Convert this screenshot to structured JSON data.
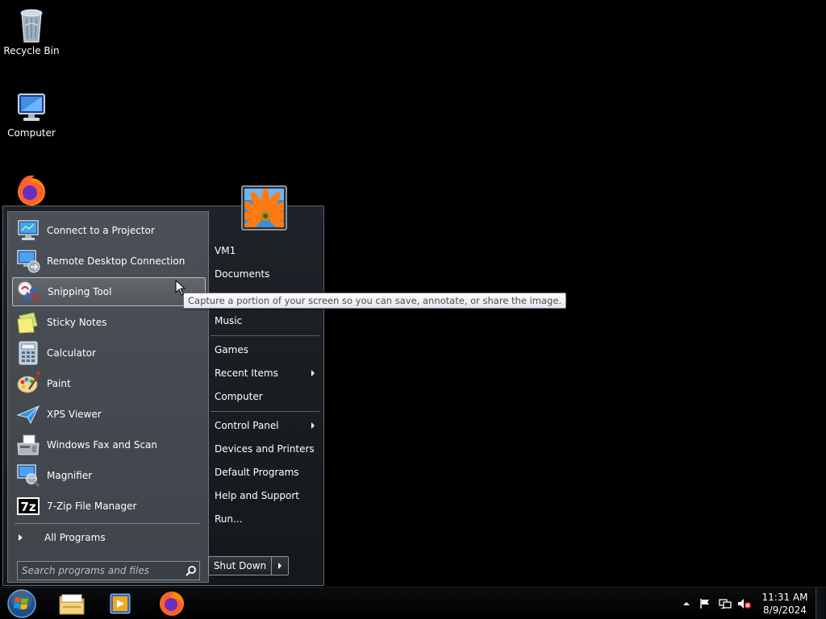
{
  "desktop": {
    "icons": [
      {
        "label": "Recycle Bin",
        "icon": "recycle-bin-icon"
      },
      {
        "label": "Computer",
        "icon": "computer-icon"
      },
      {
        "label": "",
        "icon": "firefox-icon"
      }
    ]
  },
  "start_menu": {
    "programs": [
      {
        "label": "Connect to a Projector",
        "icon": "projector-icon"
      },
      {
        "label": "Remote Desktop Connection",
        "icon": "remote-desktop-icon"
      },
      {
        "label": "Snipping Tool",
        "icon": "snipping-tool-icon",
        "highlighted": true
      },
      {
        "label": "Sticky Notes",
        "icon": "sticky-notes-icon"
      },
      {
        "label": "Calculator",
        "icon": "calculator-icon"
      },
      {
        "label": "Paint",
        "icon": "paint-icon"
      },
      {
        "label": "XPS Viewer",
        "icon": "xps-viewer-icon"
      },
      {
        "label": "Windows Fax and Scan",
        "icon": "fax-scan-icon"
      },
      {
        "label": "Magnifier",
        "icon": "magnifier-icon"
      },
      {
        "label": "7-Zip File Manager",
        "icon": "7zip-icon"
      }
    ],
    "all_programs": "All Programs",
    "search_placeholder": "Search programs and files",
    "right_items": [
      {
        "label": "VM1"
      },
      {
        "label": "Documents"
      },
      {
        "label": "Music"
      },
      {
        "label": "Games"
      },
      {
        "label": "Recent Items",
        "submenu": true
      },
      {
        "label": "Computer"
      },
      {
        "label": "Control Panel",
        "submenu": true
      },
      {
        "label": "Devices and Printers"
      },
      {
        "label": "Default Programs"
      },
      {
        "label": "Help and Support"
      },
      {
        "label": "Run..."
      }
    ],
    "shutdown_label": "Shut Down",
    "tooltip": "Capture a portion of your screen so you can save, annotate, or share the image."
  },
  "taskbar": {
    "pinned": [
      "windows-explorer-icon",
      "media-player-icon",
      "firefox-icon"
    ],
    "clock": {
      "time": "11:31 AM",
      "date": "8/9/2024"
    },
    "tray_icons": [
      "show-hidden-icons-icon",
      "action-center-flag-icon",
      "network-icon",
      "volume-muted-icon"
    ]
  },
  "colors": {
    "accent": "#3a7bd5",
    "desktop_bg": "#000000"
  }
}
